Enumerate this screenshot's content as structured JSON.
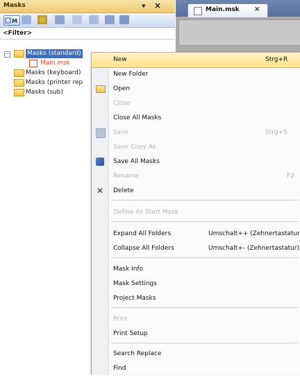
{
  "panel": {
    "title": "Masks",
    "pin_glyph": "←",
    "close_glyph": "×",
    "filter_label": "<Filter>",
    "toolbar_icons": [
      "masks-view-icon",
      "list-icon",
      "settings-icon",
      "move-icon",
      "view-icon",
      "grid-icon",
      "link-icon"
    ]
  },
  "tree": {
    "items": [
      {
        "label": "Masks (standard)",
        "expander": "−"
      },
      {
        "label": "Main.msk"
      },
      {
        "label": "Masks (keyboard)"
      },
      {
        "label": "Masks (printer rep"
      },
      {
        "label": "Masks (sub)"
      }
    ]
  },
  "tabs": {
    "doc_tab": "Main.msk",
    "close_glyph": "×"
  },
  "menu": {
    "items": [
      {
        "label": "New",
        "shortcut": "Strg+R"
      },
      {
        "label": "New Folder"
      },
      {
        "label": "Open"
      },
      {
        "label": "Close"
      },
      {
        "label": "Close All Masks"
      },
      {
        "label": "Save",
        "shortcut": "Strg+S"
      },
      {
        "label": "Save Copy As"
      },
      {
        "label": "Save All Masks"
      },
      {
        "label": "Rename",
        "shortcut": "F2"
      },
      {
        "label": "Delete",
        "icon_glyph": "✕"
      },
      {
        "label": "Define As Start Mask"
      },
      {
        "label": "Expand All Folders",
        "shortcut": "Umschalt++ (Zehnertastatur)"
      },
      {
        "label": "Collapse All Folders",
        "shortcut": "Umschalt+- (Zehnertastatur)"
      },
      {
        "label": "Mask Info"
      },
      {
        "label": "Mask Settings"
      },
      {
        "label": "Project Masks"
      },
      {
        "label": "Print"
      },
      {
        "label": "Print Setup"
      },
      {
        "label": "Search Replace"
      },
      {
        "label": "Find"
      }
    ]
  },
  "colors": {
    "highlight": "#ffe08a",
    "selection": "#3a6fc0",
    "title_bar": "#eecb74"
  }
}
